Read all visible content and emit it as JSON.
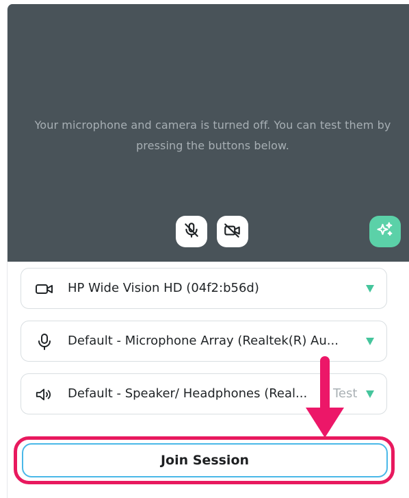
{
  "preview": {
    "message": "Your microphone and camera is turned off. You can test them by pressing the buttons below."
  },
  "icons": {
    "mic_toggle": "mic-off-icon",
    "camera_toggle": "camera-off-icon",
    "effects": "sparkles-icon",
    "camera_device": "video-camera-icon",
    "mic_device": "microphone-icon",
    "speaker_device": "speaker-icon",
    "dropdown": "triangle-down-icon"
  },
  "devices": {
    "camera": {
      "selected": "HP Wide Vision HD (04f2:b56d)"
    },
    "microphone": {
      "selected": "Default - Microphone Array  (Realtek(R) Au..."
    },
    "speaker": {
      "selected": "Default - Speaker/ Headphones  (Real...",
      "test_label": "Test"
    }
  },
  "join": {
    "label": "Join Session"
  },
  "colors": {
    "preview_bg": "#495359",
    "accent": "#45c59c",
    "effects_bg": "#5bd1a8",
    "highlight": "#e8195e",
    "join_border": "#49b8e8"
  }
}
